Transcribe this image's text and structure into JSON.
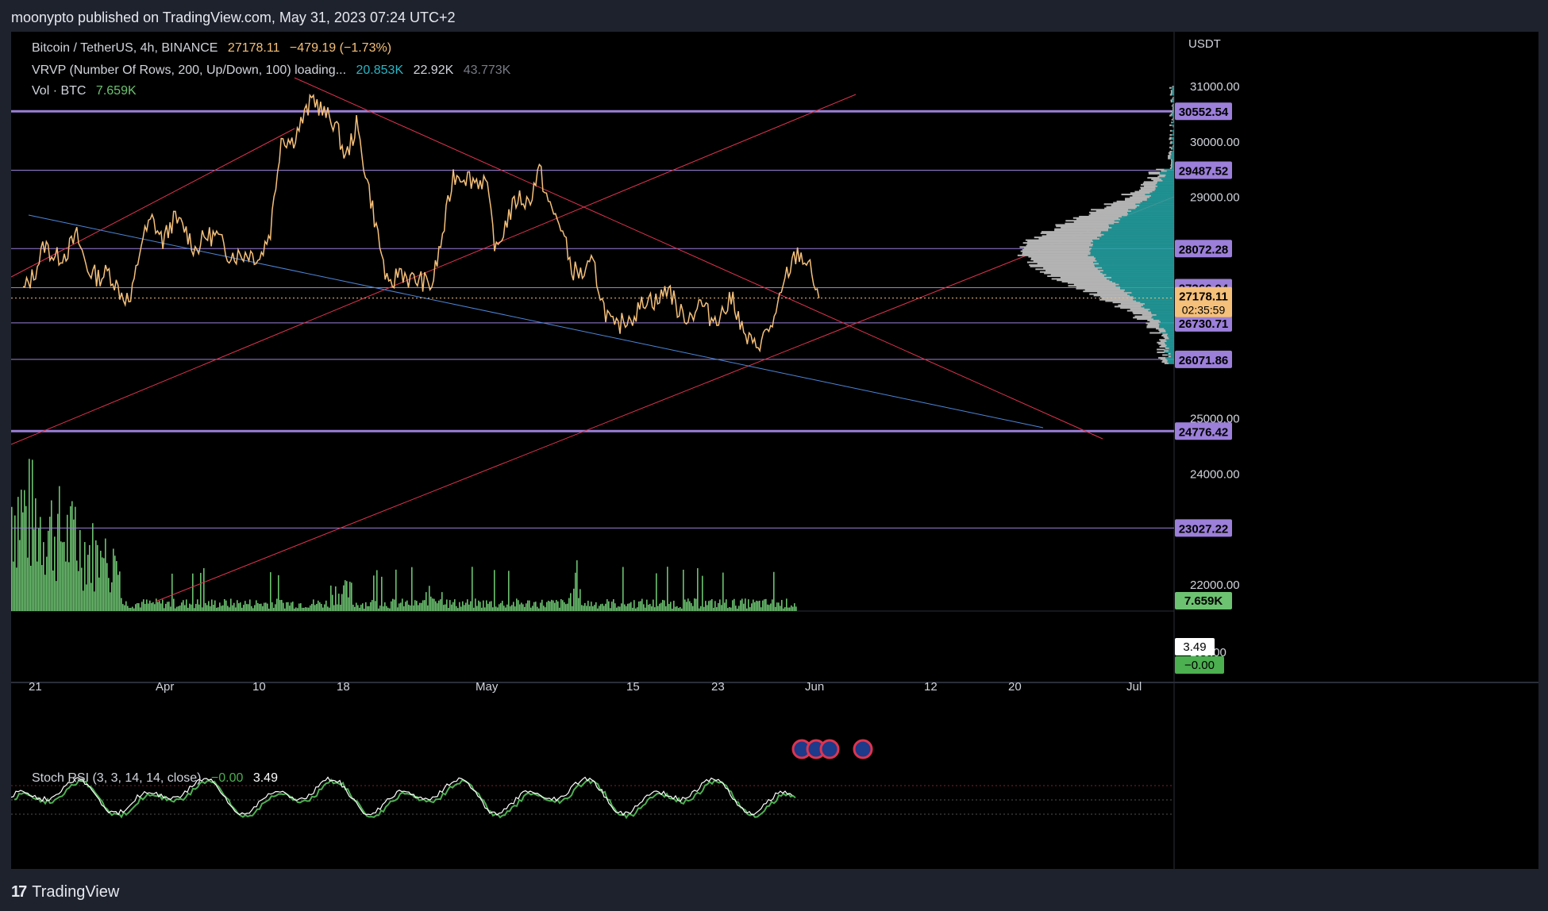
{
  "header": {
    "published": "moonypto published on TradingView.com, May 31, 2023 07:24 UTC+2"
  },
  "legend": {
    "symbol": "Bitcoin / TetherUS, 4h, BINANCE",
    "price": "27178.11",
    "change": "−479.19 (−1.73%)",
    "vrvp_label": "VRVP (Number Of Rows, 200, Up/Down, 100) loading...",
    "vrvp_v1": "20.853K",
    "vrvp_v2": "22.92K",
    "vrvp_v3": "43.773K",
    "vol_label": "Vol · BTC",
    "vol_value": "7.659K",
    "stoch_label": "Stoch RSI (3, 3, 14, 14, close)",
    "stoch_k": "−0.00",
    "stoch_d": "3.49"
  },
  "axis": {
    "currency": "USDT",
    "ticks": [
      "31000.00",
      "30000.00",
      "29000.00",
      "25000.00",
      "24000.00",
      "22000.00"
    ],
    "rsi_ticks": [
      "100.00"
    ]
  },
  "level_labels": [
    "30552.54",
    "29487.52",
    "28072.28",
    "27366.94",
    "26730.71",
    "26071.86",
    "24776.42",
    "23027.22"
  ],
  "current_price": {
    "price": "27178.11",
    "countdown": "02:35:59"
  },
  "volume_badge": "7.659K",
  "rsi_badges": {
    "d": "3.49",
    "k": "−0.00"
  },
  "x_labels": [
    "21",
    "Apr",
    "10",
    "18",
    "May",
    "15",
    "23",
    "Jun",
    "12",
    "20",
    "Jul"
  ],
  "footer": {
    "brand": "TradingView"
  },
  "colors": {
    "background": "#000000",
    "price_line": "#f5c07a",
    "level_line": "#9b7fd9",
    "trend_red": "#e0334f",
    "trend_blue": "#4d86d9",
    "volume": "#6cc270",
    "rsi_k": "#ffffff",
    "rsi_d": "#4caf50",
    "vp_up": "#26a6a6",
    "vp_down": "#b3b3b3",
    "label_bg": "#9b7fd9",
    "price_tag": "#f5c07a"
  },
  "chart_data": {
    "type": "line",
    "title": "Bitcoin / TetherUS, 4h, BINANCE",
    "price_series": [
      [
        "Mar 18",
        27300
      ],
      [
        "Mar 19",
        27600
      ],
      [
        "Mar 20",
        28150
      ],
      [
        "Mar 21",
        27900
      ],
      [
        "Mar 22",
        28000
      ],
      [
        "Mar 23",
        28300
      ],
      [
        "Mar 24",
        27700
      ],
      [
        "Mar 25",
        27550
      ],
      [
        "Mar 26",
        27650
      ],
      [
        "Mar 27",
        27300
      ],
      [
        "Mar 28",
        27100
      ],
      [
        "Mar 29",
        28200
      ],
      [
        "Mar 30",
        28600
      ],
      [
        "Mar 31",
        28200
      ],
      [
        "Apr 1",
        28600
      ],
      [
        "Apr 2",
        28450
      ],
      [
        "Apr 3",
        28050
      ],
      [
        "Apr 4",
        28300
      ],
      [
        "Apr 5",
        28300
      ],
      [
        "Apr 6",
        28000
      ],
      [
        "Apr 7",
        27950
      ],
      [
        "Apr 8",
        28000
      ],
      [
        "Apr 9",
        27900
      ],
      [
        "Apr 10",
        28400
      ],
      [
        "Apr 11",
        30100
      ],
      [
        "Apr 12",
        30000
      ],
      [
        "Apr 13",
        30400
      ],
      [
        "Apr 14",
        30800
      ],
      [
        "Apr 15",
        30500
      ],
      [
        "Apr 16",
        30350
      ],
      [
        "Apr 17",
        29700
      ],
      [
        "Apr 18",
        30300
      ],
      [
        "Apr 19",
        29300
      ],
      [
        "Apr 20",
        28300
      ],
      [
        "Apr 21",
        27300
      ],
      [
        "Apr 22",
        27700
      ],
      [
        "Apr 23",
        27500
      ],
      [
        "Apr 24",
        27500
      ],
      [
        "Apr 25",
        27400
      ],
      [
        "Apr 26",
        28300
      ],
      [
        "Apr 27",
        29400
      ],
      [
        "Apr 28",
        29400
      ],
      [
        "Apr 29",
        29300
      ],
      [
        "Apr 30",
        29300
      ],
      [
        "May 1",
        28000
      ],
      [
        "May 2",
        28600
      ],
      [
        "May 3",
        29000
      ],
      [
        "May 4",
        28900
      ],
      [
        "May 5",
        29500
      ],
      [
        "May 6",
        28800
      ],
      [
        "May 7",
        28500
      ],
      [
        "May 8",
        27700
      ],
      [
        "May 9",
        27600
      ],
      [
        "May 10",
        27800
      ],
      [
        "May 11",
        27000
      ],
      [
        "May 12",
        26600
      ],
      [
        "May 13",
        26800
      ],
      [
        "May 14",
        26900
      ],
      [
        "May 15",
        27200
      ],
      [
        "May 16",
        27100
      ],
      [
        "May 17",
        27400
      ],
      [
        "May 18",
        26900
      ],
      [
        "May 19",
        26850
      ],
      [
        "May 20",
        27100
      ],
      [
        "May 21",
        26800
      ],
      [
        "May 22",
        26900
      ],
      [
        "May 23",
        27200
      ],
      [
        "May 24",
        26500
      ],
      [
        "May 25",
        26300
      ],
      [
        "May 26",
        26500
      ],
      [
        "May 27",
        26850
      ],
      [
        "May 28",
        27600
      ],
      [
        "May 29",
        28000
      ],
      [
        "May 30",
        27800
      ],
      [
        "May 31",
        27178
      ]
    ],
    "horizontal_levels": [
      30552.54,
      29487.52,
      28072.28,
      27366.94,
      26730.71,
      26071.86,
      24776.42,
      23027.22
    ],
    "ylim": [
      21800,
      31200
    ],
    "current_price": 27178.11,
    "grid": false
  }
}
